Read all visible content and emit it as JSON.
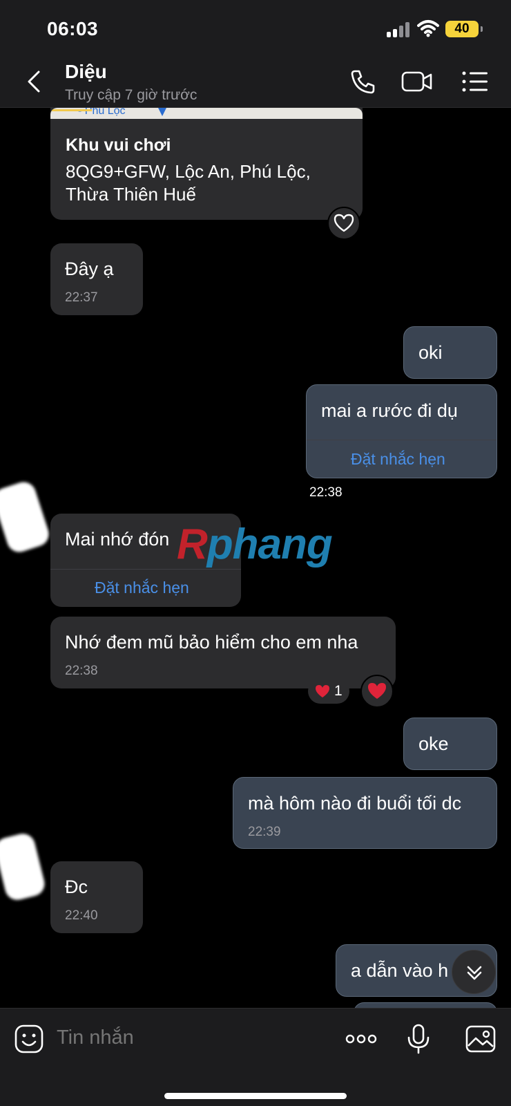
{
  "status_bar": {
    "time": "06:03",
    "battery": "40"
  },
  "header": {
    "contact_name": "Diệu",
    "contact_status": "Truy cập 7 giờ trước"
  },
  "messages": [
    {
      "direction": "in",
      "type": "location",
      "map_label": "- Phú Lộc",
      "title": "Khu vui chơi",
      "address": "8QG9+GFW, Lộc An, Phú Lộc,\nThừa Thiên Huế"
    },
    {
      "direction": "in",
      "text": "Đây ạ",
      "time": "22:37"
    },
    {
      "direction": "out",
      "text": "oki"
    },
    {
      "direction": "out",
      "text": "mai a rước đi dụ",
      "action": "Đặt nhắc hẹn",
      "time": "22:38"
    },
    {
      "direction": "in",
      "text": "Mai nhớ đón",
      "action": "Đặt nhắc hẹn"
    },
    {
      "direction": "in",
      "text": "Nhớ đem mũ bảo hiểm cho em nha",
      "time": "22:38",
      "reaction_count": "1"
    },
    {
      "direction": "out",
      "text": "oke"
    },
    {
      "direction": "out",
      "text": "mà hôm nào đi buổi tối dc",
      "time": "22:39"
    },
    {
      "direction": "in",
      "text": "Đc",
      "time": "22:40"
    },
    {
      "direction": "out",
      "text": "a dẫn vào h"
    }
  ],
  "watermark": {
    "r": "R",
    "rest": "phang"
  },
  "composer": {
    "placeholder": "Tin nhắn"
  },
  "colors": {
    "accent": "#4a90e8",
    "outgoing_bubble": "#3a4452",
    "incoming_bubble": "#2c2c2e",
    "heart": "#e0243a",
    "battery": "#f6d33b"
  }
}
